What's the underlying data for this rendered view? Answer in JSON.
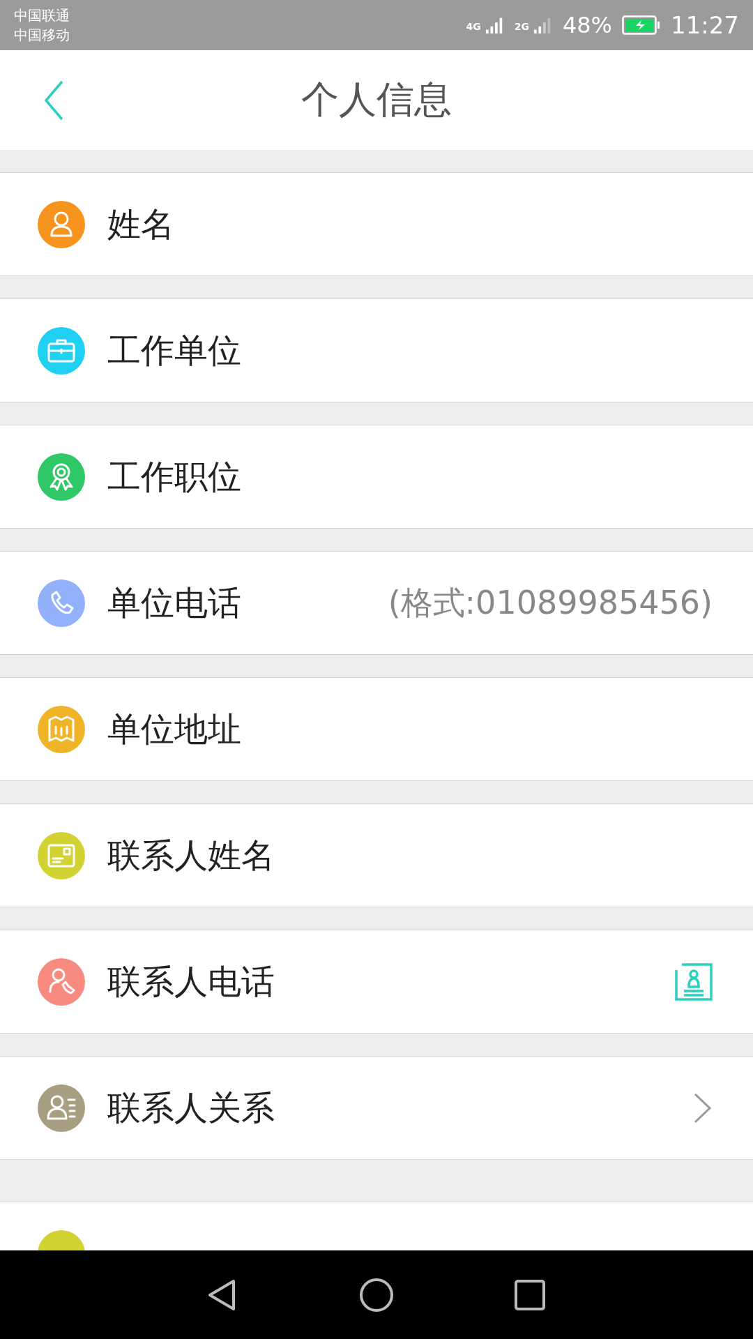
{
  "status_bar": {
    "carriers": [
      "中国联通",
      "中国移动"
    ],
    "signal_labels": [
      "4G",
      "2G"
    ],
    "battery": "48%",
    "time": "11:27"
  },
  "header": {
    "title": "个人信息"
  },
  "rows": [
    {
      "label": "姓名",
      "color": "#f7941d"
    },
    {
      "label": "工作单位",
      "color": "#1fd0f0"
    },
    {
      "label": "工作职位",
      "color": "#2ec866"
    },
    {
      "label": "单位电话",
      "color": "#93b1fb",
      "trailing": {
        "kind": "placeholder",
        "text": "(格式:01089985456)"
      }
    },
    {
      "label": "单位地址",
      "color": "#f0b429"
    },
    {
      "label": "联系人姓名",
      "color": "#d2d333"
    },
    {
      "label": "联系人电话",
      "color": "#f78b80",
      "trailing": {
        "kind": "contact"
      }
    },
    {
      "label": "联系人关系",
      "color": "#a89e82",
      "trailing": {
        "kind": "chevron"
      }
    }
  ],
  "partial_row": {
    "color": "#d2d333"
  }
}
